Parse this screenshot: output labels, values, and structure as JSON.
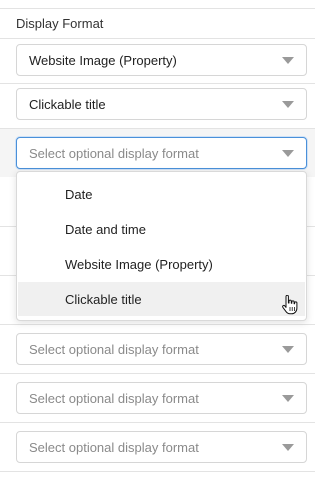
{
  "header": {
    "title": "Display Format"
  },
  "selects": [
    {
      "value": "Website Image (Property)"
    },
    {
      "value": "Clickable title"
    },
    {
      "placeholder": "Select optional display format"
    },
    {
      "placeholder": "Select optional display format"
    },
    {
      "placeholder": "Select optional display format"
    },
    {
      "placeholder": "Select optional display format"
    }
  ],
  "dropdown": {
    "options": [
      {
        "label": "Date"
      },
      {
        "label": "Date and time"
      },
      {
        "label": "Website Image (Property)"
      },
      {
        "label": "Clickable title"
      }
    ],
    "hovered_option": "Clickable title"
  },
  "colors": {
    "focus_border": "#4a90d9",
    "hover_bg": "#f0f0f0",
    "row_highlight": "#f5f5f5"
  },
  "icons": {
    "caret": "chevron-down-icon",
    "cursor": "hand-pointer-icon"
  }
}
